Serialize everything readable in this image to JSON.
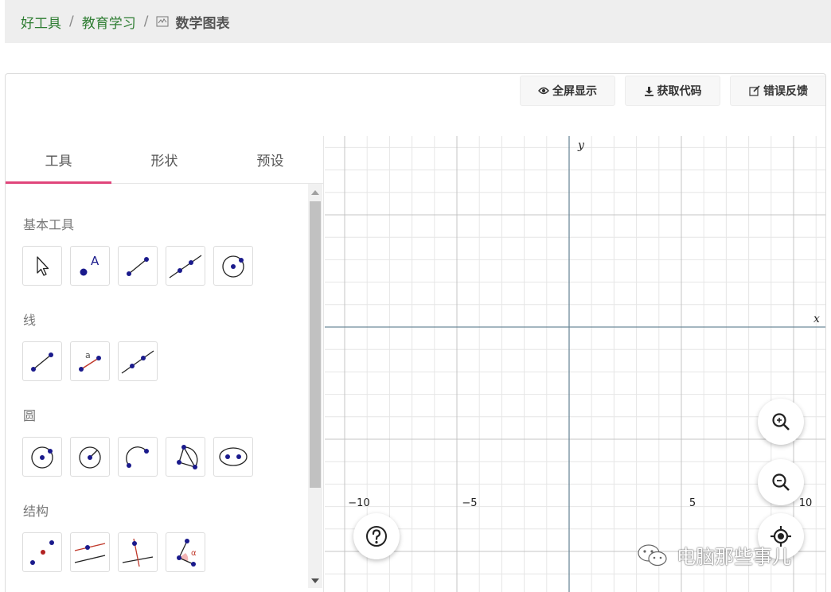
{
  "breadcrumb": {
    "home": "好工具",
    "sep1": "/",
    "category": "教育学习",
    "sep2": "/",
    "current": "数学图表",
    "current_icon": "chart-icon"
  },
  "toolbar": {
    "fullscreen": "全屏显示",
    "get_code": "获取代码",
    "feedback": "错误反馈"
  },
  "tabs": [
    {
      "label": "工具",
      "active": true
    },
    {
      "label": "形状",
      "active": false
    },
    {
      "label": "预设",
      "active": false
    }
  ],
  "sections": {
    "basic": {
      "title": "基本工具",
      "tools": [
        "move-tool-icon",
        "point-tool-icon",
        "segment-tool-icon",
        "line-tool-icon",
        "circle-center-point-tool-icon"
      ],
      "point_label": "A"
    },
    "lines": {
      "title": "线",
      "tools": [
        "segment-tool-icon",
        "segment-fixed-length-tool-icon",
        "line-tool-icon"
      ],
      "length_label": "a"
    },
    "circles": {
      "title": "圆",
      "tools": [
        "circle-center-point-tool-icon",
        "circle-center-radius-tool-icon",
        "semicircle-tool-icon",
        "circle-three-points-tool-icon",
        "ellipse-tool-icon"
      ]
    },
    "construct": {
      "title": "结构",
      "tools": [
        "midpoint-tool-icon",
        "parallel-line-tool-icon",
        "perpendicular-line-tool-icon",
        "angle-bisector-tool-icon"
      ],
      "angle_label": "α"
    }
  },
  "graph": {
    "x_axis_label": "x",
    "y_axis_label": "y",
    "x_ticks": [
      "−10",
      "−5",
      "5",
      "10"
    ]
  },
  "watermark": {
    "text": "电脑那些事儿",
    "icon": "wechat-icon"
  },
  "colors": {
    "link": "#2e7d32",
    "tab_accent": "#e0457b",
    "point": "#1a1a8c",
    "axis": "#6e8a9a"
  }
}
